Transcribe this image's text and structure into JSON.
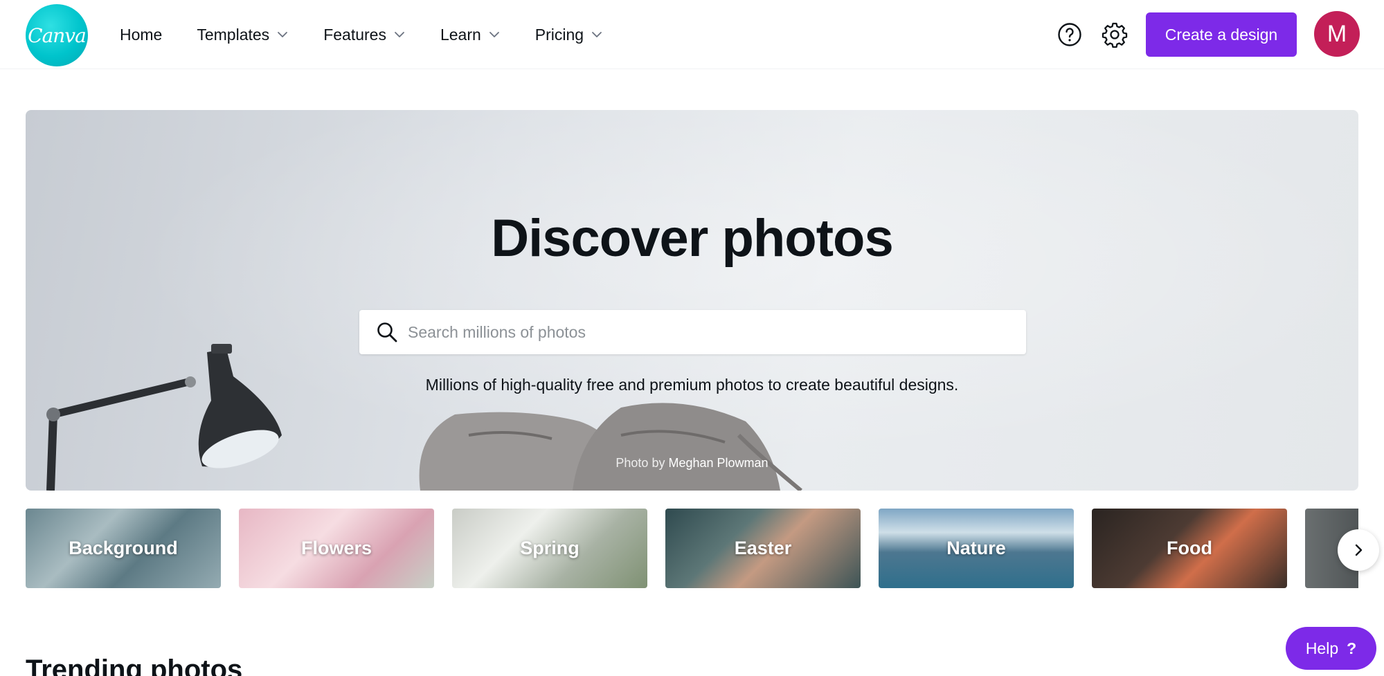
{
  "header": {
    "logo_text": "Canva",
    "nav": [
      {
        "label": "Home",
        "has_dropdown": false
      },
      {
        "label": "Templates",
        "has_dropdown": true
      },
      {
        "label": "Features",
        "has_dropdown": true
      },
      {
        "label": "Learn",
        "has_dropdown": true
      },
      {
        "label": "Pricing",
        "has_dropdown": true
      }
    ],
    "help_icon": "question-circle-icon",
    "settings_icon": "gear-icon",
    "create_button": "Create a design",
    "avatar_initial": "M"
  },
  "hero": {
    "title": "Discover photos",
    "search_placeholder": "Search millions of photos",
    "search_value": "",
    "subtitle": "Millions of high-quality free and premium photos to create beautiful designs.",
    "credit_prefix": "Photo by",
    "credit_author": "Meghan Plowman"
  },
  "categories": [
    {
      "label": "Background"
    },
    {
      "label": "Flowers"
    },
    {
      "label": "Spring"
    },
    {
      "label": "Easter"
    },
    {
      "label": "Nature"
    },
    {
      "label": "Food"
    },
    {
      "label": ""
    }
  ],
  "sections": {
    "trending_title": "Trending photos"
  },
  "help_fab": {
    "label": "Help",
    "glyph": "?"
  },
  "colors": {
    "brand_purple": "#7d2ae8",
    "logo_teal": "#00c4cc",
    "avatar_pink": "#c31f58",
    "text_dark": "#0e1318"
  }
}
